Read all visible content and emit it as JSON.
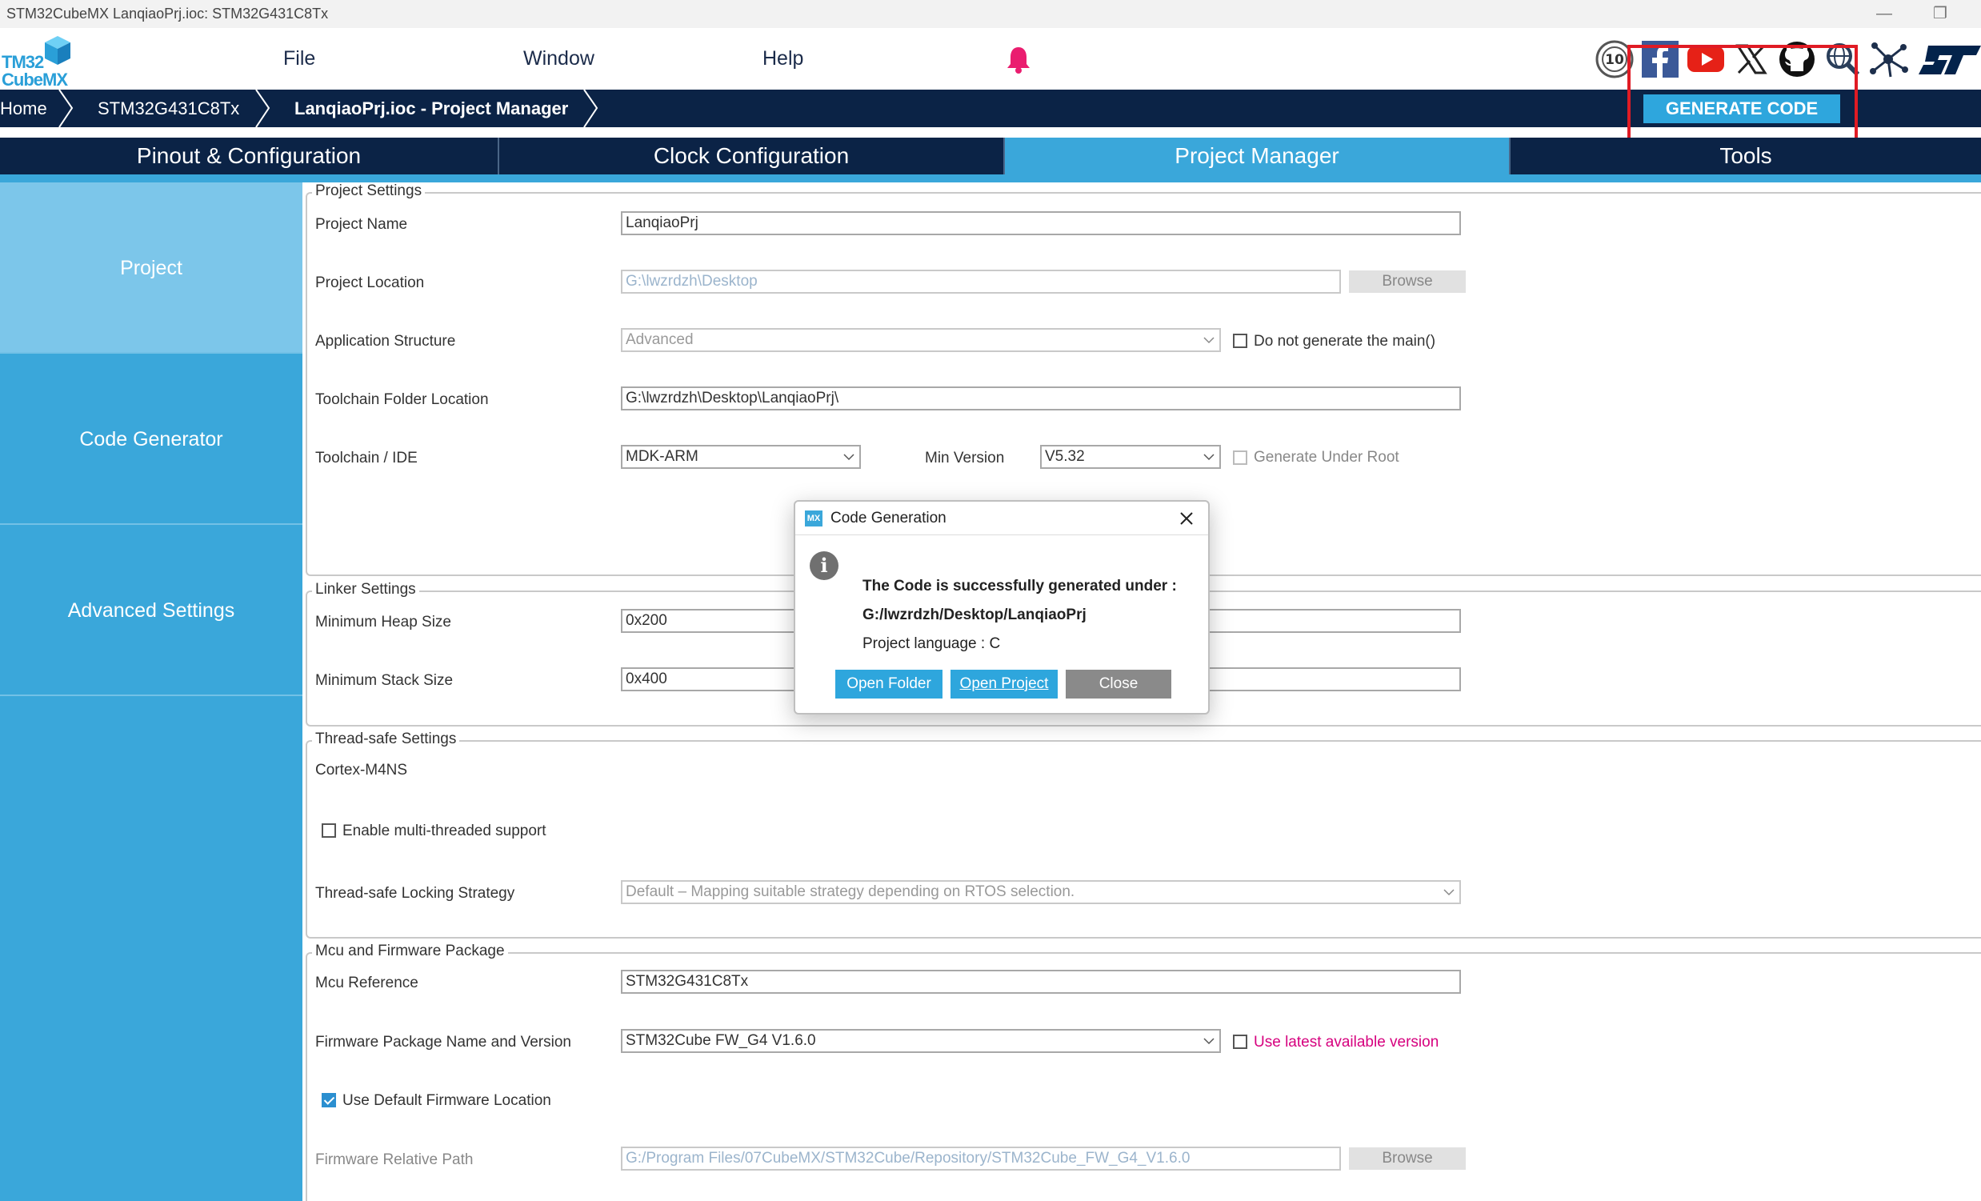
{
  "window": {
    "title": "STM32CubeMX LanqiaoPrj.ioc: STM32G431C8Tx",
    "minimize": "—",
    "restore": "❐"
  },
  "logo": {
    "line1": "TM32",
    "line2": "CubeMX"
  },
  "menu": {
    "file": "File",
    "window": "Window",
    "help": "Help"
  },
  "breadcrumb": {
    "home": "Home",
    "mcu": "STM32G431C8Tx",
    "current": "LanqiaoPrj.ioc - Project Manager"
  },
  "generate_button": "GENERATE CODE",
  "tabs": {
    "pinout": "Pinout & Configuration",
    "clock": "Clock Configuration",
    "project_manager": "Project Manager",
    "tools": "Tools"
  },
  "sidebar": {
    "project": "Project",
    "code_generator": "Code Generator",
    "advanced": "Advanced Settings"
  },
  "project_settings": {
    "legend": "Project Settings",
    "project_name_label": "Project Name",
    "project_name_value": "LanqiaoPrj",
    "project_location_label": "Project Location",
    "project_location_value": "G:\\lwzrdzh\\Desktop",
    "browse": "Browse",
    "app_structure_label": "Application Structure",
    "app_structure_value": "Advanced",
    "no_main_label": "Do not generate the main()",
    "toolchain_folder_label": "Toolchain Folder Location",
    "toolchain_folder_value": "G:\\lwzrdzh\\Desktop\\LanqiaoPrj\\",
    "toolchain_ide_label": "Toolchain / IDE",
    "toolchain_ide_value": "MDK-ARM",
    "min_version_label": "Min Version",
    "min_version_value": "V5.32",
    "generate_under_root_label": "Generate Under Root"
  },
  "linker_settings": {
    "legend": "Linker Settings",
    "heap_label": "Minimum Heap Size",
    "heap_value": "0x200",
    "stack_label": "Minimum Stack Size",
    "stack_value": "0x400"
  },
  "thread_safe": {
    "legend": "Thread-safe Settings",
    "core": "Cortex-M4NS",
    "multi_thread_label": "Enable multi-threaded support",
    "locking_label": "Thread-safe Locking Strategy",
    "locking_value": "Default – Mapping suitable strategy depending on RTOS selection."
  },
  "mcu_firmware": {
    "legend": "Mcu and Firmware Package",
    "mcu_ref_label": "Mcu Reference",
    "mcu_ref_value": "STM32G431C8Tx",
    "fw_label": "Firmware Package Name and Version",
    "fw_value": "STM32Cube FW_G4 V1.6.0",
    "use_latest_label": "Use latest available version",
    "use_default_fw_label": "Use Default Firmware Location",
    "fw_path_label": "Firmware Relative Path",
    "fw_path_value": "G:/Program Files/07CubeMX/STM32Cube/Repository/STM32Cube_FW_G4_V1.6.0",
    "browse": "Browse"
  },
  "dialog": {
    "title": "Code Generation",
    "icon_text": "MX",
    "line1": "The Code is successfully generated under :",
    "line2": "G:/lwzrdzh/Desktop/LanqiaoPrj",
    "line3": "Project language : C",
    "open_folder": "Open Folder",
    "open_project": "Open Project",
    "close": "Close"
  },
  "colors": {
    "navy": "#0b2346",
    "accent": "#3aa7da",
    "highlight": "#e01b24",
    "magenta_link": "#d6007e"
  }
}
